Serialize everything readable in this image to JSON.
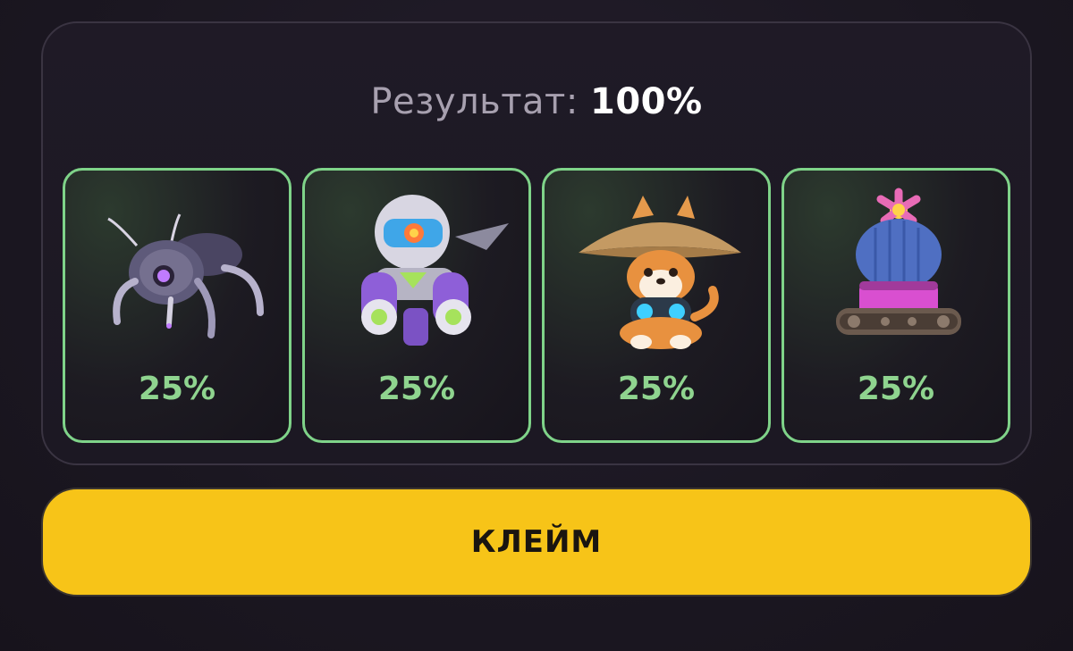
{
  "result": {
    "label": "Результат:",
    "value": "100%"
  },
  "cards": [
    {
      "icon": "robot-spider-icon",
      "percent": "25%"
    },
    {
      "icon": "astronaut-mech-icon",
      "percent": "25%"
    },
    {
      "icon": "shiba-dog-straw-hat-icon",
      "percent": "25%"
    },
    {
      "icon": "cactus-tank-icon",
      "percent": "25%"
    }
  ],
  "claim_button": {
    "label": "КЛЕЙМ"
  },
  "colors": {
    "card_border": "#7fd389",
    "percent_text": "#8fd48f",
    "claim_button": "#f7c418"
  }
}
